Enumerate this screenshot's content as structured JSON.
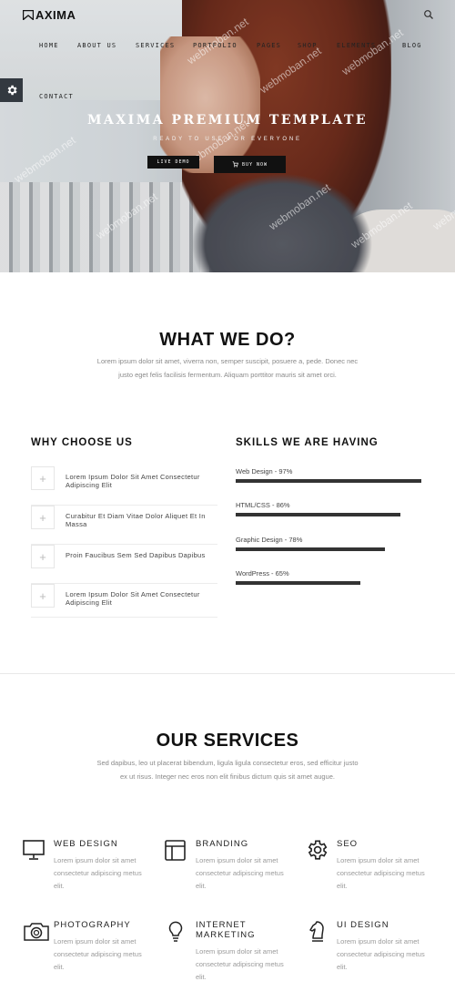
{
  "brand": {
    "name": "AXIMA"
  },
  "nav": {
    "items": [
      "HOME",
      "ABOUT US",
      "SERVICES",
      "PORTFOLIO",
      "PAGES",
      "SHOP",
      "ELEMENTS",
      "BLOG",
      "CONTACT"
    ]
  },
  "watermark": "webmoban.net",
  "hero": {
    "title": "MAXIMA PREMIUM TEMPLATE",
    "subtitle": "READY TO USE FOR EVERYONE",
    "btn_primary": "LIVE DEMO",
    "btn_secondary": "BUY NOW",
    "btn_secondary_icon": "cart-icon"
  },
  "what_we_do": {
    "title": "WHAT WE DO?",
    "text": "Lorem ipsum dolor sit amet, viverra non, semper suscipit, posuere a, pede. Donec nec justo eget felis facilisis fermentum. Aliquam porttitor mauris sit amet orci."
  },
  "why": {
    "title": "WHY CHOOSE US",
    "items": [
      "Lorem Ipsum Dolor Sit Amet Consectetur Adipiscing Elit",
      "Curabitur Et Diam Vitae Dolor Aliquet Et In Massa",
      "Proin Faucibus Sem Sed Dapibus Dapibus",
      "Lorem Ipsum Dolor Sit Amet Consectetur Adipiscing Elit"
    ]
  },
  "skills": {
    "title": "SKILLS WE ARE HAVING",
    "items": [
      {
        "label": "Web Design - 97%",
        "percent": 97
      },
      {
        "label": "HTML/CSS - 86%",
        "percent": 86
      },
      {
        "label": "Graphic Design - 78%",
        "percent": 78
      },
      {
        "label": "WordPress - 65%",
        "percent": 65
      }
    ]
  },
  "services": {
    "title": "OUR SERVICES",
    "text": "Sed dapibus, leo ut placerat bibendum, ligula ligula consectetur eros, sed efficitur justo ex ut risus. Integer nec eros non elit finibus dictum quis sit amet augue.",
    "items": [
      {
        "name": "WEB DESIGN",
        "icon": "monitor-icon",
        "desc": "Lorem ipsum dolor sit amet consectetur adipiscing metus elit."
      },
      {
        "name": "BRANDING",
        "icon": "layout-icon",
        "desc": "Lorem ipsum dolor sit amet consectetur adipiscing metus elit."
      },
      {
        "name": "SEO",
        "icon": "gear-icon",
        "desc": "Lorem ipsum dolor sit amet consectetur adipiscing metus elit."
      },
      {
        "name": "PHOTOGRAPHY",
        "icon": "camera-icon",
        "desc": "Lorem ipsum dolor sit amet consectetur adipiscing metus elit."
      },
      {
        "name": "INTERNET MARKETING",
        "icon": "lightbulb-icon",
        "desc": "Lorem ipsum dolor sit amet consectetur adipiscing metus elit."
      },
      {
        "name": "UI DESIGN",
        "icon": "chess-knight-icon",
        "desc": "Lorem ipsum dolor sit amet consectetur adipiscing metus elit."
      }
    ]
  }
}
